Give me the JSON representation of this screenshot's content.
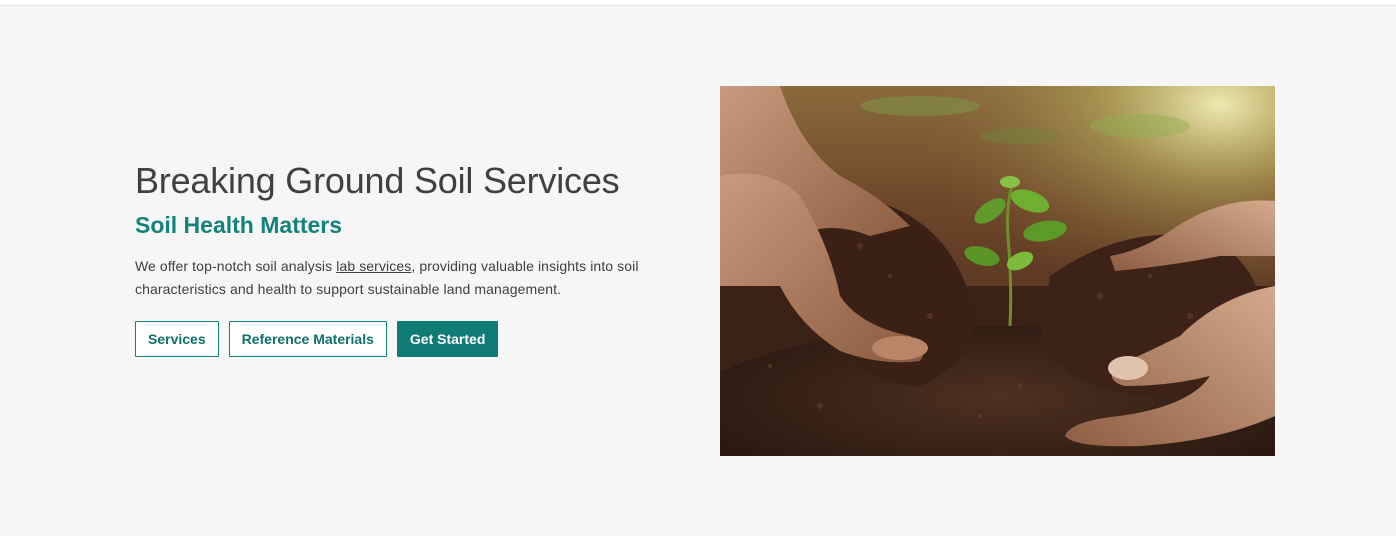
{
  "hero": {
    "title": "Breaking Ground Soil Services",
    "subtitle": "Soil Health Matters",
    "description_before": "We offer top-notch soil analysis ",
    "description_link": "lab services",
    "description_after": ", providing valuable insights into soil characteristics and health to support sustainable land management.",
    "buttons": [
      {
        "label": "Services"
      },
      {
        "label": "Reference Materials"
      },
      {
        "label": "Get Started"
      }
    ],
    "image_icon": "hands-soil-seedling-photo"
  },
  "colors": {
    "accent": "#107a75",
    "title": "#3e4142",
    "background": "#f6f6f6"
  }
}
